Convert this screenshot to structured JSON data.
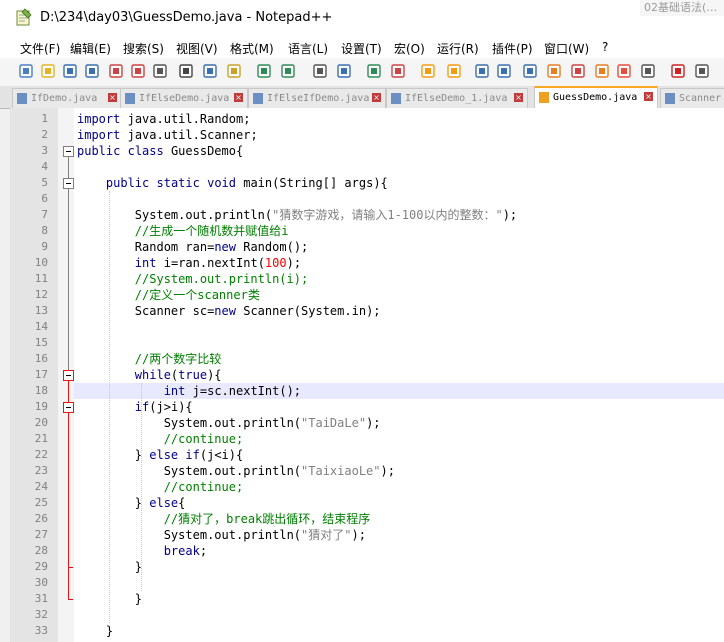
{
  "window": {
    "title": "D:\\234\\day03\\GuessDemo.java - Notepad++",
    "background_peek": "02基础语法(…"
  },
  "side_fragments": [
    "3",
    "4",
    "5",
    "6"
  ],
  "menu": [
    "文件(F)",
    "编辑(E)",
    "搜索(S)",
    "视图(V)",
    "格式(M)",
    "语言(L)",
    "设置(T)",
    "宏(O)",
    "运行(R)",
    "插件(P)",
    "窗口(W)",
    "?"
  ],
  "toolbar": {
    "icons": [
      "new-file-icon",
      "open-file-icon",
      "save-icon",
      "save-all-icon",
      "close-icon",
      "close-all-icon",
      "print-icon",
      "cut-icon",
      "copy-icon",
      "paste-icon",
      "undo-icon",
      "redo-icon",
      "find-icon",
      "replace-icon",
      "zoom-in-icon",
      "zoom-out-icon",
      "sync-v-icon",
      "sync-h-icon",
      "word-wrap-icon",
      "show-all-chars-icon",
      "indent-guide-icon",
      "udl-icon",
      "doc-map-icon",
      "function-list-icon",
      "folder-workspace-icon",
      "monitoring-icon",
      "record-macro-icon",
      "stop-macro-icon"
    ]
  },
  "tabs": [
    {
      "label": "IfDemo.java",
      "active": false
    },
    {
      "label": "IfElseDemo.java",
      "active": false
    },
    {
      "label": "IfElseIfDemo.java",
      "active": false
    },
    {
      "label": "IfElseDemo_1.java",
      "active": false
    },
    {
      "label": "GuessDemo.java",
      "active": true
    },
    {
      "label": "Scanner",
      "active": false
    }
  ],
  "editor": {
    "current_line": 18,
    "lines": [
      {
        "n": "1",
        "text": "import java.util.Random;"
      },
      {
        "n": "2",
        "text": "import java.util.Scanner;"
      },
      {
        "n": "3",
        "text": "public class GuessDemo{"
      },
      {
        "n": "4",
        "text": ""
      },
      {
        "n": "5",
        "text": "    public static void main(String[] args){"
      },
      {
        "n": "6",
        "text": ""
      },
      {
        "n": "7",
        "text": "        System.out.println(\"猜数字游戏，请输入1-100以内的整数：\");"
      },
      {
        "n": "8",
        "text": "        //生成一个随机数并赋值给i"
      },
      {
        "n": "9",
        "text": "        Random ran=new Random();"
      },
      {
        "n": "10",
        "text": "        int i=ran.nextInt(100);"
      },
      {
        "n": "11",
        "text": "        //System.out.println(i);"
      },
      {
        "n": "12",
        "text": "        //定义一个scanner类"
      },
      {
        "n": "13",
        "text": "        Scanner sc=new Scanner(System.in);"
      },
      {
        "n": "14",
        "text": ""
      },
      {
        "n": "15",
        "text": ""
      },
      {
        "n": "16",
        "text": "        //两个数字比较"
      },
      {
        "n": "17",
        "text": "        while(true){"
      },
      {
        "n": "18",
        "text": "            int j=sc.nextInt();"
      },
      {
        "n": "19",
        "text": "        if(j>i){"
      },
      {
        "n": "20",
        "text": "            System.out.println(\"TaiDaLe\");"
      },
      {
        "n": "21",
        "text": "            //continue;"
      },
      {
        "n": "22",
        "text": "        } else if(j<i){"
      },
      {
        "n": "23",
        "text": "            System.out.println(\"TaixiaoLe\");"
      },
      {
        "n": "24",
        "text": "            //continue;"
      },
      {
        "n": "25",
        "text": "        } else{"
      },
      {
        "n": "26",
        "text": "            //猜对了，break跳出循环，结束程序"
      },
      {
        "n": "27",
        "text": "            System.out.println(\"猜对了\");"
      },
      {
        "n": "28",
        "text": "            break;"
      },
      {
        "n": "29",
        "text": "        }"
      },
      {
        "n": "30",
        "text": ""
      },
      {
        "n": "31",
        "text": "        }"
      },
      {
        "n": "32",
        "text": ""
      },
      {
        "n": "33",
        "text": "    }"
      }
    ]
  }
}
